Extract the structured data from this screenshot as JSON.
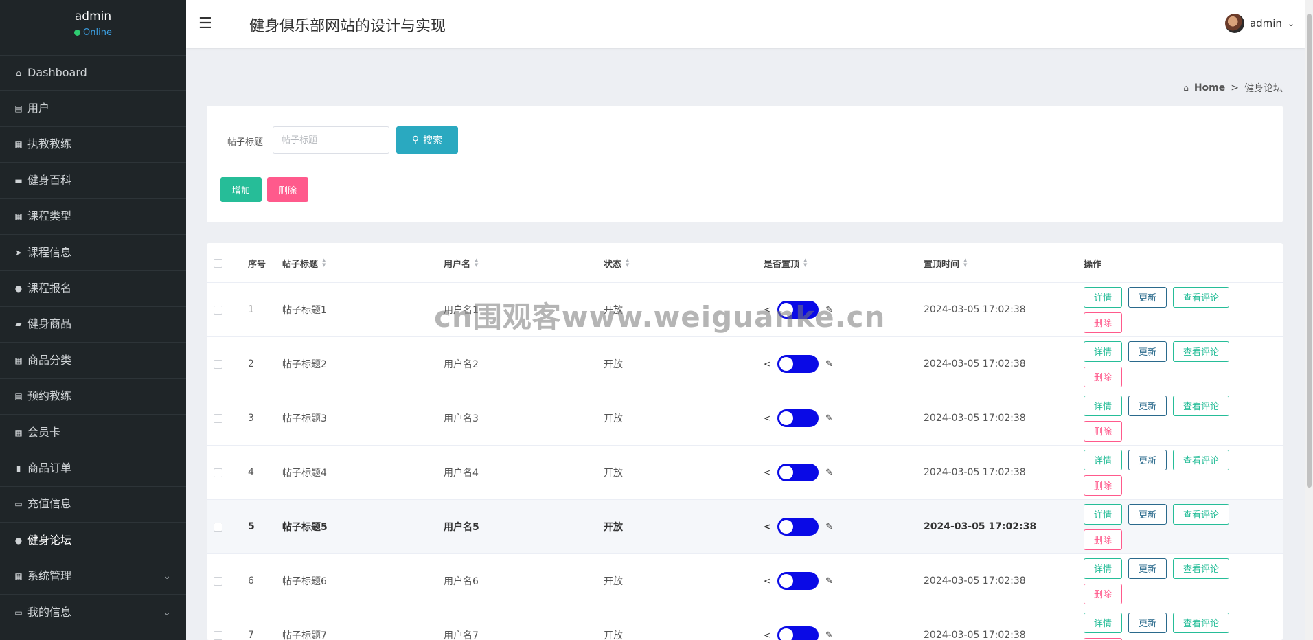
{
  "sidebar": {
    "user": {
      "name": "admin",
      "status": "Online"
    },
    "items": [
      {
        "label": "Dashboard",
        "icon": "home-icon"
      },
      {
        "label": "用户",
        "icon": "clipboard-icon"
      },
      {
        "label": "执教教练",
        "icon": "grid-icon"
      },
      {
        "label": "健身百科",
        "icon": "briefcase-icon"
      },
      {
        "label": "课程类型",
        "icon": "grid-icon"
      },
      {
        "label": "课程信息",
        "icon": "paper-plane-icon"
      },
      {
        "label": "课程报名",
        "icon": "map-pin-icon"
      },
      {
        "label": "健身商品",
        "icon": "ticket-icon"
      },
      {
        "label": "商品分类",
        "icon": "grid-icon"
      },
      {
        "label": "预约教练",
        "icon": "clipboard-icon"
      },
      {
        "label": "会员卡",
        "icon": "th-icon"
      },
      {
        "label": "商品订单",
        "icon": "bar-chart-icon"
      },
      {
        "label": "充值信息",
        "icon": "comment-icon"
      },
      {
        "label": "健身论坛",
        "icon": "user-icon"
      },
      {
        "label": "系统管理",
        "icon": "grid-icon"
      },
      {
        "label": "我的信息",
        "icon": "window-icon"
      }
    ]
  },
  "topbar": {
    "title": "健身俱乐部网站的设计与实现",
    "user": "admin"
  },
  "breadcrumb": {
    "home": "Home",
    "current": "健身论坛"
  },
  "search": {
    "label": "帖子标题",
    "placeholder": "帖子标题",
    "button": "搜索"
  },
  "actions": {
    "add": "增加",
    "delete": "删除"
  },
  "table": {
    "headers": {
      "no": "序号",
      "title": "帖子标题",
      "user": "用户名",
      "status": "状态",
      "pinned": "是否置顶",
      "pin_time": "置顶时间",
      "ops": "操作"
    },
    "op_labels": {
      "detail": "详情",
      "update": "更新",
      "comments": "查看评论",
      "remove": "删除"
    },
    "rows": [
      {
        "no": "1",
        "title": "帖子标题1",
        "user": "用户名1",
        "status": "开放",
        "pin_time": "2024-03-05 17:02:38"
      },
      {
        "no": "2",
        "title": "帖子标题2",
        "user": "用户名2",
        "status": "开放",
        "pin_time": "2024-03-05 17:02:38"
      },
      {
        "no": "3",
        "title": "帖子标题3",
        "user": "用户名3",
        "status": "开放",
        "pin_time": "2024-03-05 17:02:38"
      },
      {
        "no": "4",
        "title": "帖子标题4",
        "user": "用户名4",
        "status": "开放",
        "pin_time": "2024-03-05 17:02:38"
      },
      {
        "no": "5",
        "title": "帖子标题5",
        "user": "用户名5",
        "status": "开放",
        "pin_time": "2024-03-05 17:02:38"
      },
      {
        "no": "6",
        "title": "帖子标题6",
        "user": "用户名6",
        "status": "开放",
        "pin_time": "2024-03-05 17:02:38"
      },
      {
        "no": "7",
        "title": "帖子标题7",
        "user": "用户名7",
        "status": "开放",
        "pin_time": "2024-03-05 17:02:38"
      }
    ]
  },
  "watermark": "cn围观客www.weiguanke.cn",
  "colors": {
    "sidebar_bg": "#1f2528",
    "accent_teal": "#2aa9c0",
    "green": "#26bd98",
    "pink": "#ff5a8c",
    "toggle": "#0a0ae6"
  }
}
